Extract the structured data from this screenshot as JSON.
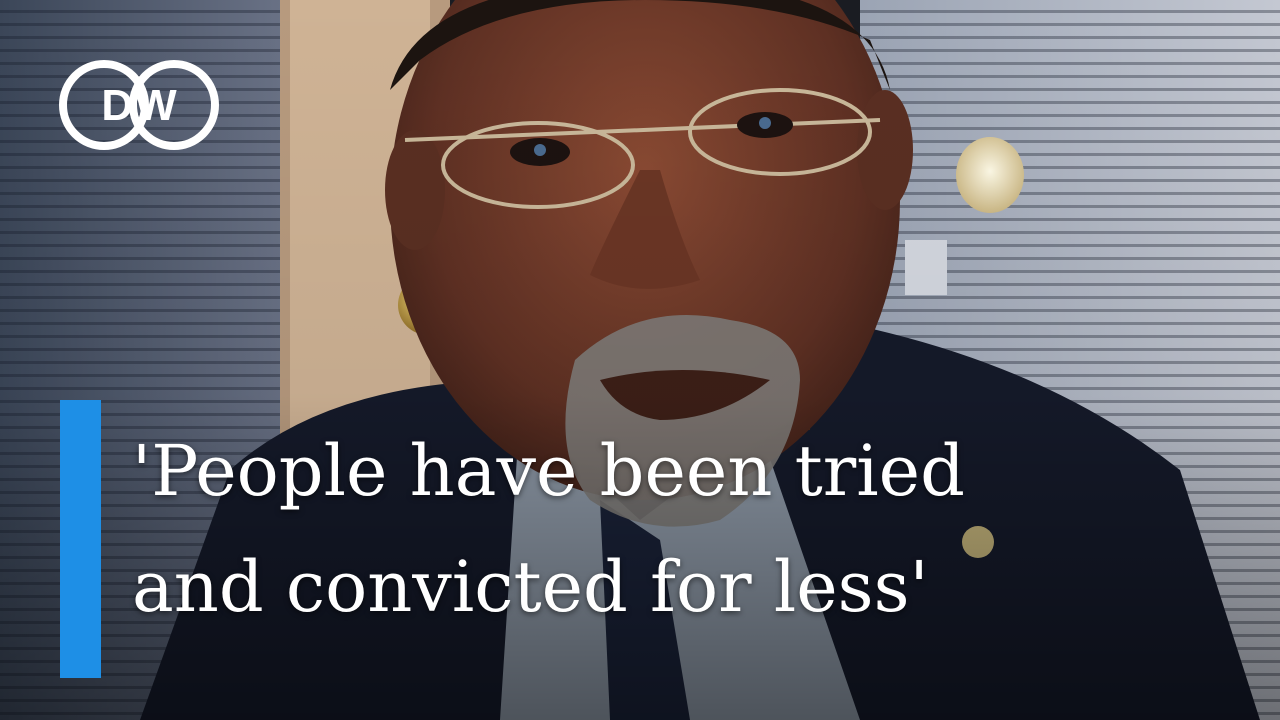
{
  "brand": {
    "logo_text": "DW",
    "accent_color": "#1e8fe6"
  },
  "headline": {
    "line1": "'People have been tried",
    "line2": "and convicted for less'"
  },
  "colors": {
    "skin": "#5a2f22",
    "jacket": "#151a2a",
    "shirt": "#8d98a6",
    "beard": "#7e7b78",
    "blinds": "#7f8aa0",
    "door": "#c7a98a"
  }
}
